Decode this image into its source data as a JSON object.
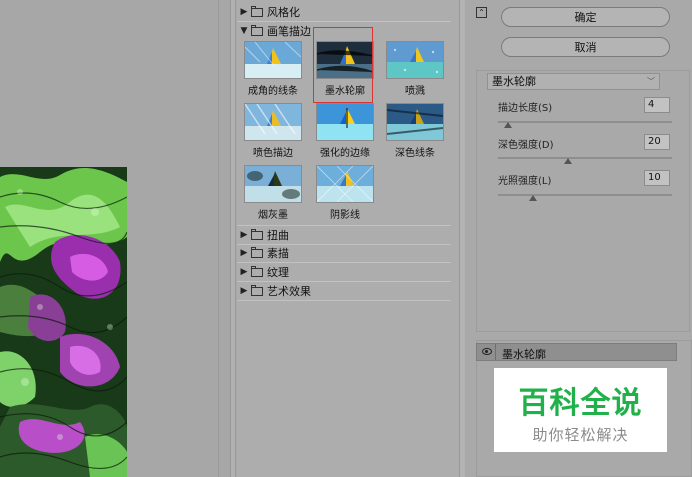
{
  "gallery": {
    "folders": {
      "stylize": "风格化",
      "brush_strokes": "画笔描边",
      "distort": "扭曲",
      "sketch": "素描",
      "texture": "纹理",
      "artistic": "艺术效果"
    },
    "thumbnails": [
      {
        "label": "成角的线条"
      },
      {
        "label": "墨水轮廓",
        "selected": true
      },
      {
        "label": "喷溅"
      },
      {
        "label": "喷色描边"
      },
      {
        "label": "强化的边缘"
      },
      {
        "label": "深色线条"
      },
      {
        "label": "烟灰墨"
      },
      {
        "label": "阴影线"
      }
    ]
  },
  "buttons": {
    "ok": "确定",
    "cancel": "取消"
  },
  "settings": {
    "filter_select": "墨水轮廓",
    "params": [
      {
        "label": "描边长度(S)",
        "value": "4",
        "fraction": 0.06
      },
      {
        "label": "深色强度(D)",
        "value": "20",
        "fraction": 0.4
      },
      {
        "label": "光照强度(L)",
        "value": "10",
        "fraction": 0.2
      }
    ]
  },
  "layers": {
    "active_layer": "墨水轮廓"
  },
  "watermark": {
    "title": "百科全说",
    "subtitle": "助你轻松解决"
  },
  "colors": {
    "watermark_green": "#21b14a",
    "selection_border": "#dd3333"
  }
}
